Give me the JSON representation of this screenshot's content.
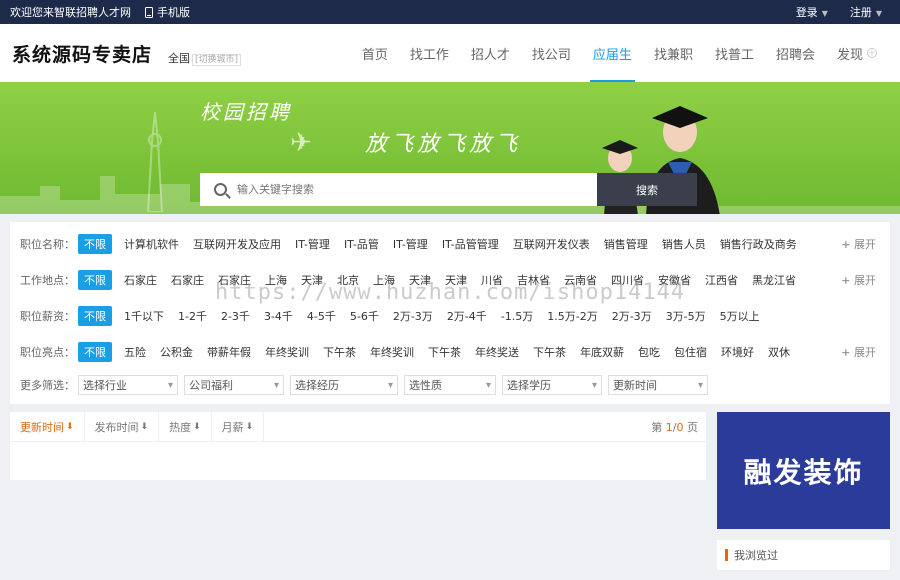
{
  "topbar": {
    "welcome": "欢迎您来智联招聘人才网",
    "mobile": "手机版",
    "login": "登录",
    "register": "注册"
  },
  "header": {
    "logo": "系统源码专卖店",
    "city": "全国",
    "city_switch": "[切换城市]"
  },
  "nav": {
    "items": [
      "首页",
      "找工作",
      "招人才",
      "找公司",
      "应届生",
      "找兼职",
      "找普工",
      "招聘会",
      "发现"
    ],
    "active_index": 4
  },
  "banner": {
    "slogan1": "校园招聘",
    "slogan2": "放飞放飞放飞",
    "search_placeholder": "输入关键字搜索",
    "search_button": "搜索"
  },
  "filters": {
    "rows": [
      {
        "label": "职位名称：",
        "tags": [
          "不限",
          "计算机软件",
          "互联网开发及应用",
          "IT-管理",
          "IT-品管",
          "IT-管理",
          "IT-品管管理",
          "互联网开发仪表",
          "销售管理",
          "销售人员",
          "销售行政及商务"
        ],
        "more": "展开"
      },
      {
        "label": "工作地点：",
        "tags": [
          "不限",
          "石家庄",
          "石家庄",
          "石家庄",
          "上海",
          "天津",
          "北京",
          "上海",
          "天津",
          "天津",
          "川省",
          "吉林省",
          "云南省",
          "四川省",
          "安徽省",
          "江西省",
          "黑龙江省"
        ],
        "more": "展开"
      },
      {
        "label": "职位薪资：",
        "tags": [
          "不限",
          "1千以下",
          "1-2千",
          "2-3千",
          "3-4千",
          "4-5千",
          "5-6千",
          "2万-3万",
          "2万-4千",
          "-1.5万",
          "1.5万-2万",
          "2万-3万",
          "3万-5万",
          "5万以上"
        ],
        "more": ""
      },
      {
        "label": "职位亮点：",
        "tags": [
          "不限",
          "五险",
          "公积金",
          "带薪年假",
          "年终奖训",
          "下午茶",
          "年终奖训",
          "下午茶",
          "年终奖送",
          "下午茶",
          "年底双薪",
          "包吃",
          "包住宿",
          "环境好",
          "双休"
        ],
        "more": "展开"
      }
    ],
    "more_label": "更多筛选：",
    "selects": [
      "选择行业",
      "公司福利",
      "选择经历",
      "选性质",
      "选择学历",
      "更新时间"
    ]
  },
  "results": {
    "sorts": [
      "更新时间",
      "发布时间",
      "热度",
      "月薪"
    ],
    "active_sort": 0,
    "pager_prefix": "第 ",
    "pager_current": "1",
    "pager_sep": "/",
    "pager_total": "0",
    "pager_suffix": " 页"
  },
  "ad": {
    "text": "融发装饰"
  },
  "browsed": {
    "title": "我浏览过"
  },
  "watermark": "https://www.huzhan.com/ishop14144",
  "colors": {
    "accent": "#1a9ee6",
    "topbar": "#1e2a4a",
    "banner": "#7cc63a",
    "orange": "#e06a10",
    "ad_bg": "#2b3b9a"
  }
}
